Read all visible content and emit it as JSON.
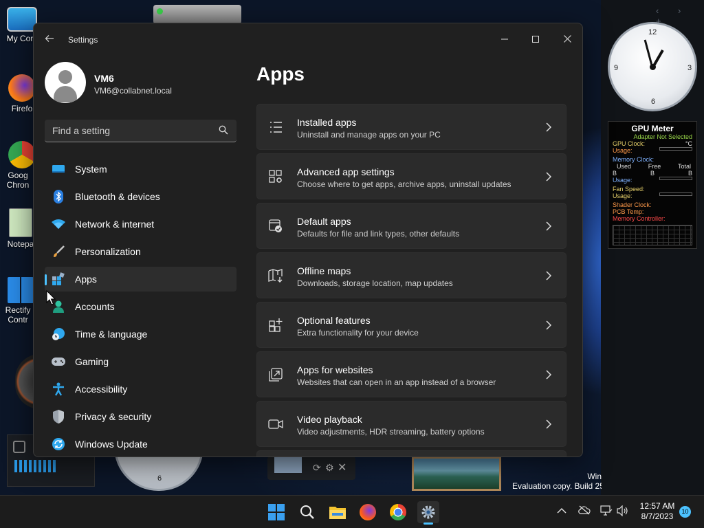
{
  "desktop": {
    "icons": [
      {
        "label": "My Com"
      },
      {
        "label": "Firefo"
      },
      {
        "label": "Goog Chron"
      },
      {
        "label": "Notepa"
      },
      {
        "label": "Rectify Contr"
      }
    ],
    "eval_line1": "Win",
    "eval_line2": "Evaluation copy. Build 25"
  },
  "gadgets": {
    "clock": {
      "numbers": [
        "12",
        "3",
        "6",
        "9"
      ]
    },
    "gpu_meter": {
      "title": "GPU Meter",
      "adapter": "Adapter Not Selected",
      "gpu_clock": "GPU Clock:",
      "celsius": "°C",
      "usage": "Usage:",
      "memory_clock": "Memory Clock:",
      "used": "Used",
      "free": "Free",
      "total": "Total",
      "b": "B",
      "fan_speed": "Fan Speed:",
      "shader_clock": "Shader Clock:",
      "pcb_temp": "PCB Temp:",
      "memory_controller": "Memory Controller:"
    },
    "analog_clock_bottom_number": "6"
  },
  "window": {
    "title": "Settings",
    "controls": {
      "minimize": "─",
      "maximize": "☐",
      "close": "✕"
    }
  },
  "user": {
    "name": "VM6",
    "email": "VM6@collabnet.local"
  },
  "search": {
    "placeholder": "Find a setting"
  },
  "nav": {
    "items": [
      {
        "label": "System",
        "icon": "monitor-icon"
      },
      {
        "label": "Bluetooth & devices",
        "icon": "bluetooth-icon"
      },
      {
        "label": "Network & internet",
        "icon": "wifi-icon"
      },
      {
        "label": "Personalization",
        "icon": "brush-icon"
      },
      {
        "label": "Apps",
        "icon": "apps-icon",
        "active": true
      },
      {
        "label": "Accounts",
        "icon": "person-icon"
      },
      {
        "label": "Time & language",
        "icon": "globe-clock-icon"
      },
      {
        "label": "Gaming",
        "icon": "gamepad-icon"
      },
      {
        "label": "Accessibility",
        "icon": "accessibility-icon"
      },
      {
        "label": "Privacy & security",
        "icon": "shield-icon"
      },
      {
        "label": "Windows Update",
        "icon": "update-icon"
      }
    ]
  },
  "main": {
    "heading": "Apps",
    "cards": [
      {
        "title": "Installed apps",
        "subtitle": "Uninstall and manage apps on your PC"
      },
      {
        "title": "Advanced app settings",
        "subtitle": "Choose where to get apps, archive apps, uninstall updates"
      },
      {
        "title": "Default apps",
        "subtitle": "Defaults for file and link types, other defaults"
      },
      {
        "title": "Offline maps",
        "subtitle": "Downloads, storage location, map updates"
      },
      {
        "title": "Optional features",
        "subtitle": "Extra functionality for your device"
      },
      {
        "title": "Apps for websites",
        "subtitle": "Websites that can open in an app instead of a browser"
      },
      {
        "title": "Video playback",
        "subtitle": "Video adjustments, HDR streaming, battery options"
      }
    ]
  },
  "taskbar": {
    "time": "12:57 AM",
    "date": "8/7/2023",
    "notifications": "10"
  },
  "colors": {
    "accent": "#4cc2ff",
    "window_bg": "#202020",
    "card_bg": "#2b2b2b"
  }
}
